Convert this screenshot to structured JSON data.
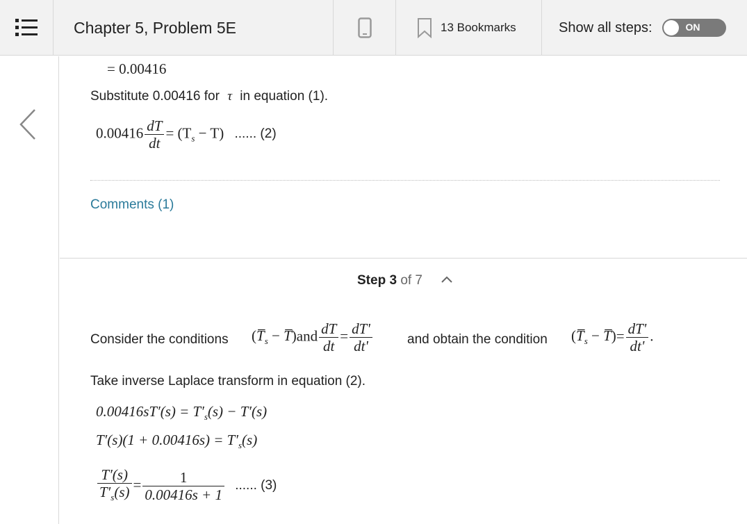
{
  "header": {
    "title": "Chapter 5, Problem 5E",
    "bookmarks_label": "13 Bookmarks",
    "show_steps_label": "Show all steps:",
    "toggle_label": "ON"
  },
  "step2": {
    "result_line": "= 0.00416",
    "substitute_prefix": "Substitute 0.00416 for",
    "tau_symbol": "τ",
    "substitute_suffix": "in equation (1).",
    "eq2_coef": "0.00416",
    "eq2_num": "dT",
    "eq2_den": "dt",
    "eq2_rhs": "= (T",
    "eq2_sub": "s",
    "eq2_rhs2": " − T)",
    "eq2_label": "...... (2)",
    "comments_link": "Comments (1)"
  },
  "step3": {
    "header_step": "Step 3",
    "header_of": "of 7",
    "consider_prefix": "Consider the conditions",
    "and_text": "and",
    "obtain_text": "and obtain the condition",
    "frac1_num": "dT",
    "frac1_den": "dt",
    "frac2_num": "dT'",
    "frac2_den": "dt'",
    "take_inverse": "Take inverse Laplace transform in equation (2).",
    "eq_line1": "0.00416sT′(s) = T′",
    "eq_line1_b": "(s) − T′(s)",
    "eq_line2": "T′(s)(1 + 0.00416s) = T′",
    "eq_line2_b": "(s)",
    "eq3_num": "T′(s)",
    "eq3_den_a": "T′",
    "eq3_den_b": "(s)",
    "eq3_rnum": "1",
    "eq3_rden": "0.00416s + 1",
    "eq3_label": "...... (3)"
  }
}
